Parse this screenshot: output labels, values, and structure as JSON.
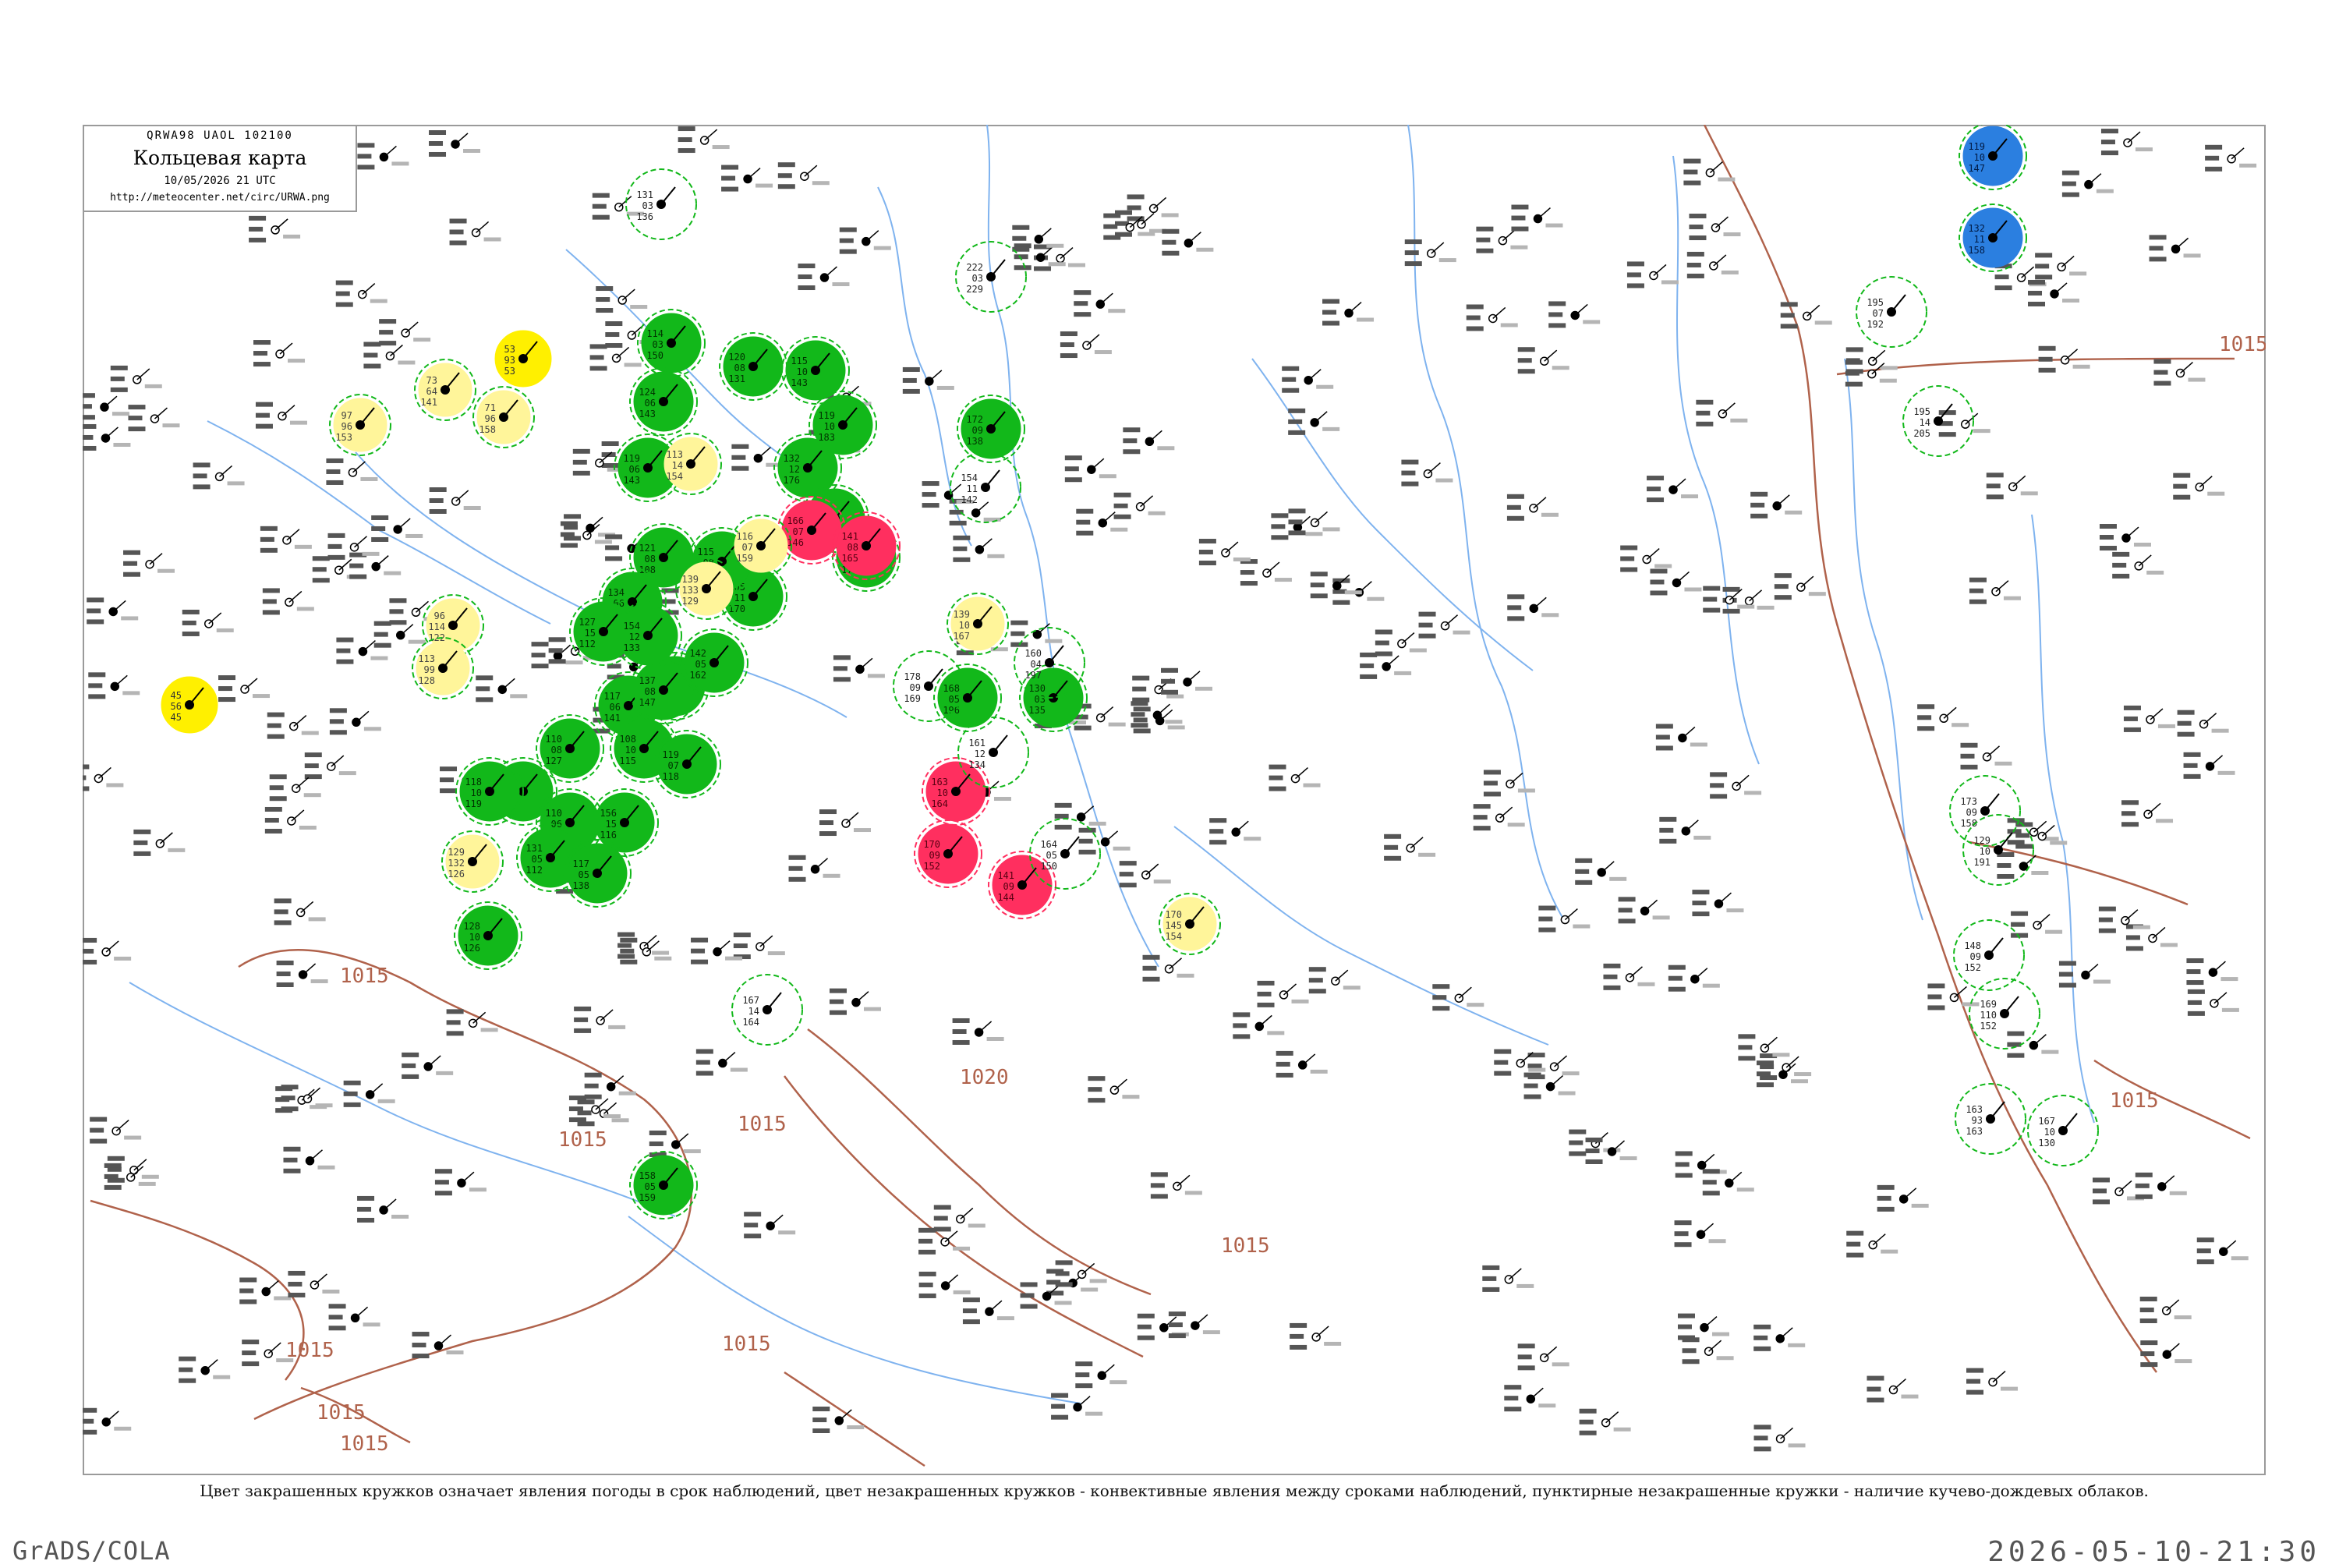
{
  "header": {
    "code": "QRWA98  UAOL  102100",
    "title": "Кольцевая карта",
    "date": "10/05/2026 21 UTC",
    "url": "http://meteocenter.net/circ/URWA.png"
  },
  "caption": "Цвет закрашенных кружков означает явления погоды в срок наблюдений, цвет незакрашенных кружков - конвективные явления между сроками наблюдений, пунктирные незакрашенные кружки - наличие кучево-дождевых облаков.",
  "footer": {
    "credit": "GrADS/COLA",
    "timestamp": "2026-05-10-21:30"
  },
  "colors": {
    "green": "#12b81a",
    "yellow": "#fff000",
    "red": "#ff2f5f",
    "blue": "#2b7fe0",
    "pale_yellow": "#fff59a",
    "isobar": "#b0624b",
    "river": "#7fb3ef",
    "frame": "#9a9a9a"
  },
  "isobar_labels": [
    "1015",
    "1015",
    "1015",
    "1015",
    "1015",
    "1015",
    "1015",
    "1015",
    "1020",
    "1015",
    "1015"
  ],
  "stations": [
    {
      "kind": "green",
      "vals": [
        "114",
        "03",
        "150"
      ]
    },
    {
      "kind": "green",
      "vals": [
        "124",
        "06",
        "143"
      ]
    },
    {
      "kind": "green",
      "vals": [
        "120",
        "08",
        "131"
      ]
    },
    {
      "kind": "green",
      "vals": [
        "119",
        "06",
        "143"
      ]
    },
    {
      "kind": "green",
      "vals": [
        "115",
        "10",
        "143"
      ]
    },
    {
      "kind": "green",
      "vals": [
        "132",
        "12",
        "176"
      ]
    },
    {
      "kind": "green",
      "vals": [
        "118",
        "14",
        "161"
      ]
    },
    {
      "kind": "green",
      "vals": [
        "113",
        "09",
        "173"
      ]
    },
    {
      "kind": "green",
      "vals": [
        "119",
        "10",
        "183"
      ]
    },
    {
      "kind": "green",
      "vals": [
        "121",
        "08",
        "108"
      ]
    },
    {
      "kind": "green",
      "vals": [
        "105",
        "11",
        "170"
      ]
    },
    {
      "kind": "green",
      "vals": [
        "134",
        "06",
        "116"
      ]
    },
    {
      "kind": "green",
      "vals": [
        "127",
        "15",
        "112"
      ]
    },
    {
      "kind": "green",
      "vals": [
        "117",
        "05",
        "157"
      ]
    },
    {
      "kind": "green",
      "vals": [
        "110",
        "08",
        "127"
      ]
    },
    {
      "kind": "green",
      "vals": [
        "117",
        "06",
        "141"
      ]
    },
    {
      "kind": "green",
      "vals": [
        "108",
        "10",
        "115"
      ]
    },
    {
      "kind": "green",
      "vals": [
        "119",
        "07",
        "118"
      ]
    },
    {
      "kind": "green",
      "vals": [
        "116",
        "09",
        "134"
      ]
    },
    {
      "kind": "green",
      "vals": [
        "110",
        "06",
        "134"
      ]
    },
    {
      "kind": "green",
      "vals": [
        "131",
        "05",
        "112"
      ]
    },
    {
      "kind": "green",
      "vals": [
        "156",
        "15",
        "116"
      ]
    },
    {
      "kind": "green",
      "vals": [
        "117",
        "05",
        "138"
      ]
    },
    {
      "kind": "green",
      "vals": [
        "137",
        "08",
        "147"
      ]
    },
    {
      "kind": "green",
      "vals": [
        "154",
        "12",
        "133"
      ]
    },
    {
      "kind": "green",
      "vals": [
        "142",
        "05",
        "162"
      ]
    },
    {
      "kind": "green",
      "vals": [
        "115",
        "08",
        "123"
      ]
    },
    {
      "kind": "green",
      "vals": [
        "172",
        "09",
        "138"
      ]
    },
    {
      "kind": "green",
      "vals": [
        "168",
        "05",
        "196"
      ]
    },
    {
      "kind": "green",
      "vals": [
        "130",
        "03",
        "135"
      ]
    },
    {
      "kind": "green",
      "vals": [
        "118",
        "10",
        "119"
      ]
    },
    {
      "kind": "green",
      "vals": [
        "128",
        "10",
        "126"
      ]
    },
    {
      "kind": "green",
      "vals": [
        "158",
        "05",
        "159"
      ]
    },
    {
      "kind": "yellow",
      "vals": [
        "53",
        "93",
        "53"
      ]
    },
    {
      "kind": "yellow",
      "vals": [
        "45",
        "56",
        "45"
      ]
    },
    {
      "kind": "red",
      "vals": [
        "166",
        "07",
        "146"
      ]
    },
    {
      "kind": "red",
      "vals": [
        "141",
        "08",
        "165"
      ]
    },
    {
      "kind": "red",
      "vals": [
        "163",
        "10",
        "164"
      ]
    },
    {
      "kind": "red",
      "vals": [
        "170",
        "09",
        "152"
      ]
    },
    {
      "kind": "red",
      "vals": [
        "141",
        "09",
        "144"
      ]
    },
    {
      "kind": "blue",
      "vals": [
        "119",
        "10",
        "147"
      ]
    },
    {
      "kind": "blue",
      "vals": [
        "132",
        "11",
        "158"
      ]
    },
    {
      "kind": "pale",
      "vals": [
        "73",
        "64",
        "141"
      ]
    },
    {
      "kind": "pale",
      "vals": [
        "97",
        "96",
        "153"
      ]
    },
    {
      "kind": "pale",
      "vals": [
        "71",
        "96",
        "158"
      ]
    },
    {
      "kind": "pale",
      "vals": [
        "96",
        "114",
        "122"
      ]
    },
    {
      "kind": "pale",
      "vals": [
        "113",
        "99",
        "128"
      ]
    },
    {
      "kind": "pale",
      "vals": [
        "129",
        "132",
        "126"
      ]
    },
    {
      "kind": "pale",
      "vals": [
        "113",
        "14",
        "154"
      ]
    },
    {
      "kind": "pale",
      "vals": [
        "116",
        "07",
        "159"
      ]
    },
    {
      "kind": "pale",
      "vals": [
        "139",
        "133",
        "129"
      ]
    },
    {
      "kind": "pale",
      "vals": [
        "139",
        "10",
        "167"
      ]
    },
    {
      "kind": "pale",
      "vals": [
        "170",
        "145",
        "154"
      ]
    },
    {
      "kind": "ring",
      "vals": [
        "131",
        "03",
        "136"
      ]
    },
    {
      "kind": "ring",
      "vals": [
        "154",
        "11",
        "142"
      ]
    },
    {
      "kind": "ring",
      "vals": [
        "222",
        "03",
        "229"
      ]
    },
    {
      "kind": "ring",
      "vals": [
        "195",
        "07",
        "192"
      ]
    },
    {
      "kind": "ring",
      "vals": [
        "195",
        "14",
        "205"
      ]
    },
    {
      "kind": "ring",
      "vals": [
        "164",
        "05",
        "150"
      ]
    },
    {
      "kind": "ring",
      "vals": [
        "160",
        "04",
        "197"
      ]
    },
    {
      "kind": "ring",
      "vals": [
        "173",
        "09",
        "158"
      ]
    },
    {
      "kind": "ring",
      "vals": [
        "129",
        "10",
        "191"
      ]
    },
    {
      "kind": "ring",
      "vals": [
        "148",
        "09",
        "152"
      ]
    },
    {
      "kind": "ring",
      "vals": [
        "169",
        "110",
        "152"
      ]
    },
    {
      "kind": "ring",
      "vals": [
        "163",
        "93",
        "163"
      ]
    },
    {
      "kind": "ring",
      "vals": [
        "167",
        "10",
        "130"
      ]
    },
    {
      "kind": "ring",
      "vals": [
        "167",
        "14",
        "164"
      ]
    },
    {
      "kind": "ring",
      "vals": [
        "178",
        "09",
        "169"
      ]
    },
    {
      "kind": "ring",
      "vals": [
        "161",
        "12",
        "134"
      ]
    }
  ]
}
